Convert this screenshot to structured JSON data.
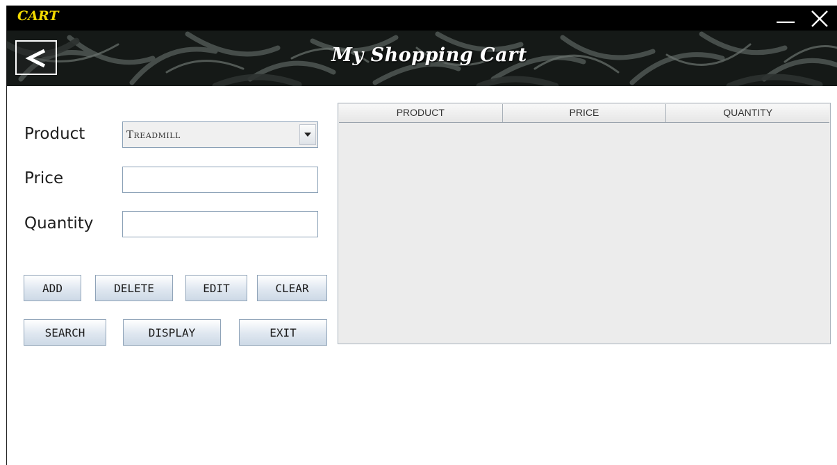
{
  "window": {
    "title": "CART"
  },
  "banner": {
    "back_label": "<",
    "title": "My Shopping Cart"
  },
  "form": {
    "product_label": "Product",
    "product_value": "Treadmill",
    "price_label": "Price",
    "price_value": "",
    "quantity_label": "Quantity",
    "quantity_value": ""
  },
  "buttons": {
    "add": "ADD",
    "delete": "DELETE",
    "edit": "EDIT",
    "clear": "CLEAR",
    "search": "SEARCH",
    "display": "DISPLAY",
    "exit": "EXIT"
  },
  "table": {
    "columns": [
      "PRODUCT",
      "PRICE",
      "QUANTITY"
    ],
    "rows": []
  },
  "icons": {
    "minimize": "minimize-icon",
    "close": "close-icon",
    "back": "back-arrow-icon",
    "dropdown": "chevron-down-icon"
  },
  "colors": {
    "title_accent": "#f2d900",
    "title_bar": "#000000"
  }
}
